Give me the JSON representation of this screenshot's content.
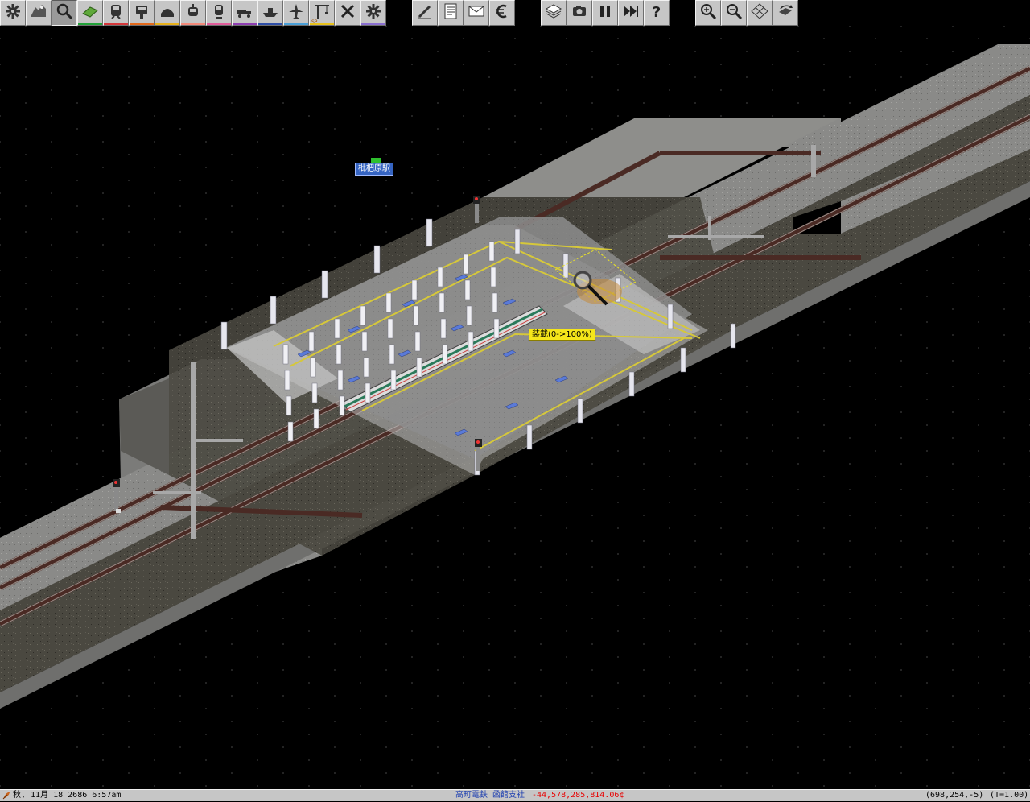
{
  "toolbar": {
    "group1": [
      {
        "icon": "gear-icon",
        "tooltip": "Options"
      },
      {
        "icon": "map-icon",
        "tooltip": "Map"
      },
      {
        "icon": "magnifier-icon",
        "tooltip": "Query"
      },
      {
        "icon": "terrain-icon",
        "tooltip": "Landscape",
        "stripe": "#23a33a"
      },
      {
        "icon": "train-icon",
        "tooltip": "Rail",
        "stripe": "#d5383b"
      },
      {
        "icon": "monorail-icon",
        "tooltip": "Monorail",
        "stripe": "#e46a1c"
      },
      {
        "icon": "maglev-icon",
        "tooltip": "Maglev",
        "stripe": "#e8b21c"
      },
      {
        "icon": "tram-icon",
        "tooltip": "Tram",
        "stripe": "#f48a7a"
      },
      {
        "icon": "narrowgauge-icon",
        "tooltip": "Narrow gauge",
        "stripe": "#e15c9b"
      },
      {
        "icon": "truck-icon",
        "tooltip": "Road",
        "stripe": "#8f3fb3"
      },
      {
        "icon": "ship-icon",
        "tooltip": "Water",
        "stripe": "#2f4fa8"
      },
      {
        "icon": "airplane-icon",
        "tooltip": "Air",
        "stripe": "#4aa0d8"
      },
      {
        "icon": "crane-icon",
        "tooltip": "Special",
        "stripe": "#e8c21c",
        "badge": "SP"
      },
      {
        "icon": "close-icon",
        "tooltip": "Remove"
      },
      {
        "icon": "settings-icon",
        "tooltip": "Tools",
        "stripe": "#8a6fd0"
      }
    ],
    "group2": [
      {
        "icon": "edit-icon",
        "tooltip": "Edit"
      },
      {
        "icon": "list-icon",
        "tooltip": "Line management"
      },
      {
        "icon": "mail-icon",
        "tooltip": "Messages"
      },
      {
        "icon": "euro-icon",
        "tooltip": "Finances"
      }
    ],
    "group3": [
      {
        "icon": "layers-icon",
        "tooltip": "Display"
      },
      {
        "icon": "camera-icon",
        "tooltip": "Screenshot"
      },
      {
        "icon": "pause-icon",
        "tooltip": "Pause"
      },
      {
        "icon": "fast-forward-icon",
        "tooltip": "Fast forward"
      },
      {
        "icon": "help-icon",
        "tooltip": "Help"
      }
    ],
    "group4": [
      {
        "icon": "zoom-in-icon",
        "tooltip": "Zoom in"
      },
      {
        "icon": "zoom-out-icon",
        "tooltip": "Zoom out"
      },
      {
        "icon": "grid-icon",
        "tooltip": "Grid"
      },
      {
        "icon": "rotate-icon",
        "tooltip": "Rotate"
      }
    ]
  },
  "map": {
    "station_name": "枇杷原駅",
    "load_tooltip": "装載(0->100%)"
  },
  "status": {
    "date": "秋, 11月 18 2686  6:57am",
    "company": "高町電鉄 函館支社",
    "money": "-44,578,285,814.06¢",
    "coords": "(698,254,-5)",
    "time_scale": "(T=1.00)"
  },
  "colors": {
    "money_negative": "#e80000",
    "company_text": "#1d3fb0"
  }
}
